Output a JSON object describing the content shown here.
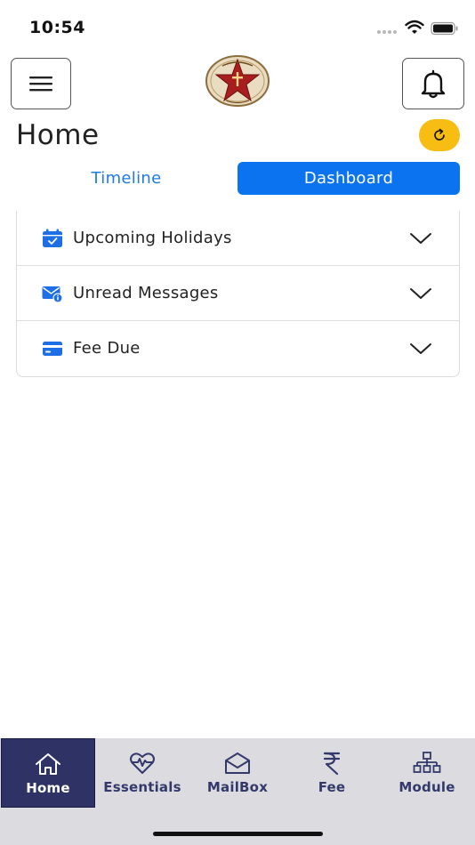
{
  "status_bar": {
    "time": "10:54"
  },
  "header": {
    "title": "Home",
    "menu_icon": "hamburger-icon",
    "bell_icon": "bell-icon",
    "refresh_icon": "refresh-icon",
    "logo_icon": "school-star-crest"
  },
  "tabs": [
    {
      "label": "Timeline",
      "active": false
    },
    {
      "label": "Dashboard",
      "active": true
    }
  ],
  "dashboard_sections": [
    {
      "label": "Upcoming Holidays",
      "icon": "calendar-check-icon"
    },
    {
      "label": "Unread Messages",
      "icon": "mail-info-icon"
    },
    {
      "label": "Fee Due",
      "icon": "credit-card-icon"
    }
  ],
  "bottom_nav": [
    {
      "label": "Home",
      "icon": "home-icon",
      "active": true
    },
    {
      "label": "Essentials",
      "icon": "heart-pulse-icon",
      "active": false
    },
    {
      "label": "MailBox",
      "icon": "envelope-icon",
      "active": false
    },
    {
      "label": "Fee",
      "icon": "rupee-icon",
      "active": false
    },
    {
      "label": "Module",
      "icon": "sitemap-icon",
      "active": false
    }
  ],
  "colors": {
    "accent": "#0b73f0",
    "tab_text": "#1f7ae8",
    "refresh_bg": "#f7bd13",
    "nav_active_bg": "#2f3265",
    "nav_bg": "#dcdce0",
    "nav_text": "#34396b"
  }
}
